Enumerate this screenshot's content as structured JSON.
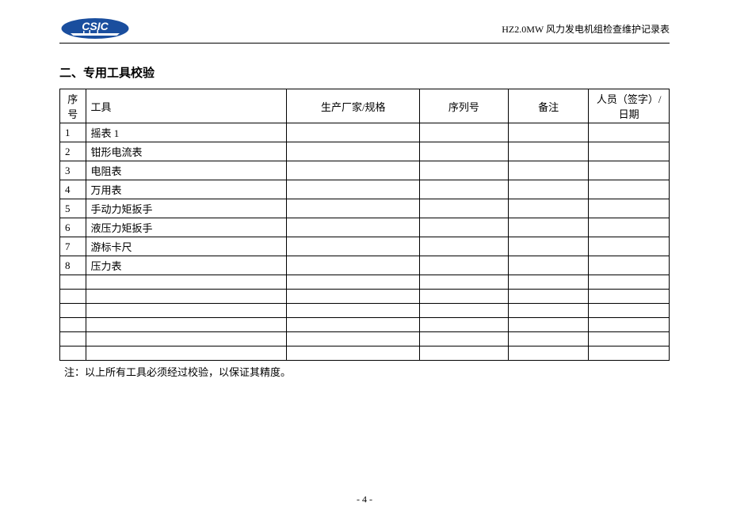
{
  "header": {
    "logo_text": "CSIC",
    "doc_title": "HZ2.0MW 风力发电机组检查维护记录表"
  },
  "section_title": "二、专用工具校验",
  "table": {
    "headers": {
      "seq": "序号",
      "tool": "工具",
      "spec": "生产厂家/规格",
      "serial": "序列号",
      "remark": "备注",
      "sign": "人员（签字）/日期"
    },
    "rows": [
      {
        "seq": "1",
        "tool": "摇表 1",
        "spec": "",
        "serial": "",
        "remark": "",
        "sign": ""
      },
      {
        "seq": "2",
        "tool": "钳形电流表",
        "spec": "",
        "serial": "",
        "remark": "",
        "sign": ""
      },
      {
        "seq": "3",
        "tool": "电阻表",
        "spec": "",
        "serial": "",
        "remark": "",
        "sign": ""
      },
      {
        "seq": "4",
        "tool": "万用表",
        "spec": "",
        "serial": "",
        "remark": "",
        "sign": ""
      },
      {
        "seq": "5",
        "tool": "手动力矩扳手",
        "spec": "",
        "serial": "",
        "remark": "",
        "sign": ""
      },
      {
        "seq": "6",
        "tool": "液压力矩扳手",
        "spec": "",
        "serial": "",
        "remark": "",
        "sign": ""
      },
      {
        "seq": "7",
        "tool": "游标卡尺",
        "spec": "",
        "serial": "",
        "remark": "",
        "sign": ""
      },
      {
        "seq": "8",
        "tool": "压力表",
        "spec": "",
        "serial": "",
        "remark": "",
        "sign": ""
      },
      {
        "seq": "",
        "tool": "",
        "spec": "",
        "serial": "",
        "remark": "",
        "sign": ""
      },
      {
        "seq": "",
        "tool": "",
        "spec": "",
        "serial": "",
        "remark": "",
        "sign": ""
      },
      {
        "seq": "",
        "tool": "",
        "spec": "",
        "serial": "",
        "remark": "",
        "sign": ""
      },
      {
        "seq": "",
        "tool": "",
        "spec": "",
        "serial": "",
        "remark": "",
        "sign": ""
      },
      {
        "seq": "",
        "tool": "",
        "spec": "",
        "serial": "",
        "remark": "",
        "sign": ""
      },
      {
        "seq": "",
        "tool": "",
        "spec": "",
        "serial": "",
        "remark": "",
        "sign": ""
      }
    ]
  },
  "note": "注：以上所有工具必须经过校验，以保证其精度。",
  "page_number": "- 4 -"
}
